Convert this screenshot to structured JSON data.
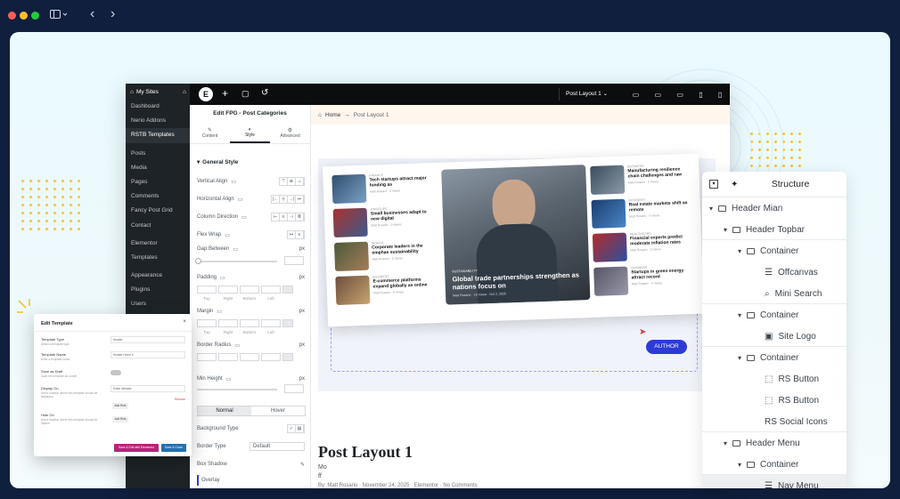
{
  "browser": {
    "nav_back": "‹",
    "nav_forward": "›"
  },
  "wp_menu": {
    "sites": "My Sites",
    "items": [
      "Dashboard",
      "Nerio Addons",
      "RSTB Templates",
      "Posts",
      "Media",
      "Pages",
      "Comments",
      "Fancy Post Grid",
      "Contact",
      "Elementor",
      "Templates",
      "Appearance",
      "Plugins",
      "Users"
    ]
  },
  "toolbar": {
    "layout_label": "Post Layout 1"
  },
  "panel": {
    "title": "Edit FPG - Post Categories",
    "tabs": [
      "Content",
      "Style",
      "Advanced"
    ],
    "section": "General Style",
    "rows": [
      "Vertical Align",
      "Horizontal Align",
      "Column Direction",
      "Flex Wrap",
      "Gap Between",
      "Padding",
      "Margin",
      "Border Radius",
      "Min Height"
    ],
    "unit": "px",
    "dims": [
      "Top",
      "Right",
      "Bottom",
      "Left"
    ],
    "state_tabs": [
      "Normal",
      "Hover"
    ],
    "background_type": "Background Type",
    "border_type": "Border Type",
    "border_value": "Default",
    "box_shadow": "Box Shadow",
    "overlay": "Overlay"
  },
  "preview": {
    "crumb_home": "Home",
    "crumb_page": "Post Layout 1",
    "post_title": "Post Layout 1",
    "line1": "Mo",
    "line2": "ff",
    "meta": "By: Matt Rosario · November 24, 2025 · Elementor · No Comments",
    "author_tag": "AUTHOR"
  },
  "magazine": {
    "left": [
      {
        "tag": "FINANCE",
        "title": "Tech startups attract major funding as",
        "meta": "Matt Rosario · 0 Views"
      },
      {
        "tag": "STARTUPS",
        "title": "Small businesses adapt to new digital",
        "meta": "Matt Rosario · 0 Views"
      },
      {
        "tag": "WORLD",
        "title": "Corporate leaders in the emphas sustainability",
        "meta": "Matt Rosario · 0 Views"
      },
      {
        "tag": "BUSINESS",
        "title": "E-commerce platforms expand globally as online",
        "meta": "Matt Rosario · 0 Views"
      }
    ],
    "hero": {
      "tag": "SUSTAINABILITY",
      "title": "Global trade partnerships strengthen as nations focus on",
      "meta": "Matt Rosario · 16 Views · Oct 2, 2025"
    },
    "right": [
      {
        "tag": "BUSINESS",
        "title": "Manufacturing resilience chain challenges and raw",
        "meta": "Matt Rosario · 0 Views"
      },
      {
        "tag": "BUSINESS",
        "title": "Real estate markets shift as remote",
        "meta": "Matt Rosario · 0 Views"
      },
      {
        "tag": "HEALTHCARE",
        "title": "Financial experts predict moderate inflation rates",
        "meta": "Matt Rosario · 0 Views"
      },
      {
        "tag": "BUSINESS",
        "title": "Startups in green energy attract record",
        "meta": "Matt Rosario · 0 Views"
      }
    ]
  },
  "structure": {
    "title": "Structure",
    "items": [
      "Header Mian",
      "Header Topbar",
      "Container",
      "Offcanvas",
      "Mini Search",
      "Container",
      "Site Logo",
      "Container",
      "RS Button",
      "RS Button",
      "RS Social Icons",
      "Header Menu",
      "Container",
      "Nav Menu"
    ]
  },
  "modal": {
    "title": "Edit Template",
    "fields": [
      {
        "label": "Template Type",
        "sub": "Select a template type.",
        "value": "Header"
      },
      {
        "label": "Template Name",
        "sub": "Enter a template name.",
        "value": "Header Home 4"
      },
      {
        "label": "Save as Draft",
        "sub": "Save the template as a draft.",
        "value": ""
      },
      {
        "label": "Display On",
        "sub": "Add a location where this template should be displayed.",
        "value": "Entire Website"
      },
      {
        "label": "Hide On",
        "sub": "Add a location where this template should be hidden.",
        "value": ""
      }
    ],
    "add_rule": "Add Rule",
    "remove": "Remove",
    "save_edit": "Save & Edit with Elementor",
    "save_close": "Save & Close"
  },
  "colors": {
    "accent": "#2d3bd4",
    "elementor_dark": "#0c0d0e",
    "wp_dark": "#1d2327",
    "highlight": "#f4c430"
  }
}
